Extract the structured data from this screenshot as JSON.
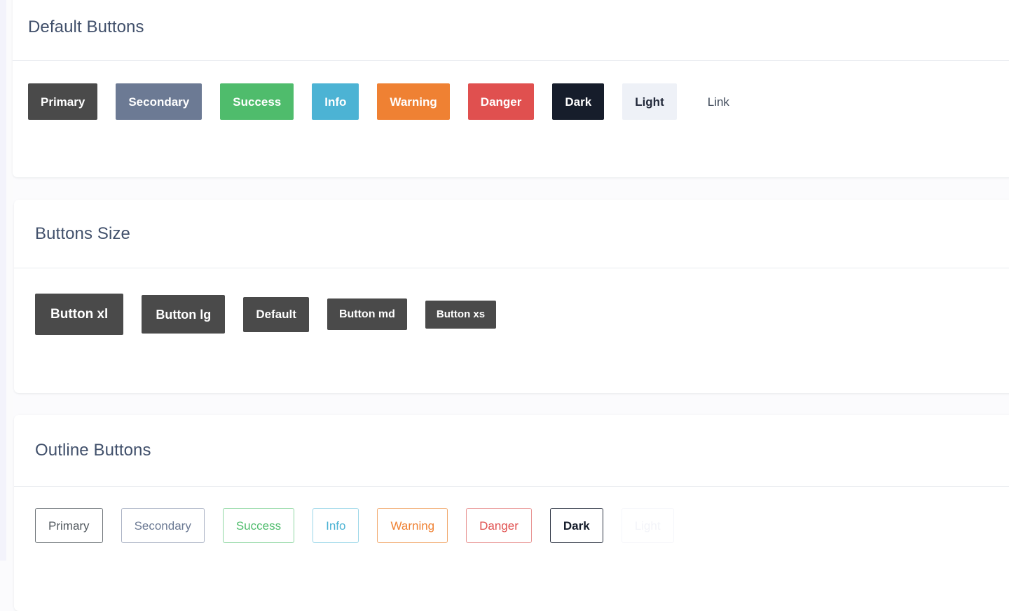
{
  "page": {
    "background_color": "#fbfbfd",
    "heading_color": "#41506b"
  },
  "cards": [
    {
      "id": "default-buttons",
      "title": "Default Buttons",
      "buttons": [
        {
          "label": "Primary",
          "variant": "primary",
          "color": "#4a4a4a"
        },
        {
          "label": "Secondary",
          "variant": "secondary",
          "color": "#6c7a94"
        },
        {
          "label": "Success",
          "variant": "success",
          "color": "#4fbc6c"
        },
        {
          "label": "Info",
          "variant": "info",
          "color": "#4cb3d4"
        },
        {
          "label": "Warning",
          "variant": "warning",
          "color": "#ef8133"
        },
        {
          "label": "Danger",
          "variant": "danger",
          "color": "#e0504f"
        },
        {
          "label": "Dark",
          "variant": "dark",
          "color": "#161d2b"
        },
        {
          "label": "Light",
          "variant": "light",
          "color": "#eef1f7"
        },
        {
          "label": "Link",
          "variant": "link",
          "color": "#3f4a5a"
        }
      ]
    },
    {
      "id": "buttons-size",
      "title": "Buttons Size",
      "buttons": [
        {
          "label": "Button xl",
          "size": "xl",
          "color": "#4a4a4a"
        },
        {
          "label": "Button lg",
          "size": "lg",
          "color": "#4a4a4a"
        },
        {
          "label": "Default",
          "size": "default",
          "color": "#4a4a4a"
        },
        {
          "label": "Button md",
          "size": "md",
          "color": "#4a4a4a"
        },
        {
          "label": "Button xs",
          "size": "xs",
          "color": "#4a4a4a"
        }
      ]
    },
    {
      "id": "outline-buttons",
      "title": "Outline Buttons",
      "buttons": [
        {
          "label": "Primary",
          "variant": "primary",
          "color": "#52595f"
        },
        {
          "label": "Secondary",
          "variant": "secondary",
          "color": "#6c7a94"
        },
        {
          "label": "Success",
          "variant": "success",
          "color": "#4fbc6c"
        },
        {
          "label": "Info",
          "variant": "info",
          "color": "#4cb3d4"
        },
        {
          "label": "Warning",
          "variant": "warning",
          "color": "#ef8133"
        },
        {
          "label": "Danger",
          "variant": "danger",
          "color": "#e0504f"
        },
        {
          "label": "Dark",
          "variant": "dark",
          "color": "#161d2b"
        },
        {
          "label": "Light",
          "variant": "light",
          "color": "#f3f4f9"
        }
      ]
    }
  ]
}
